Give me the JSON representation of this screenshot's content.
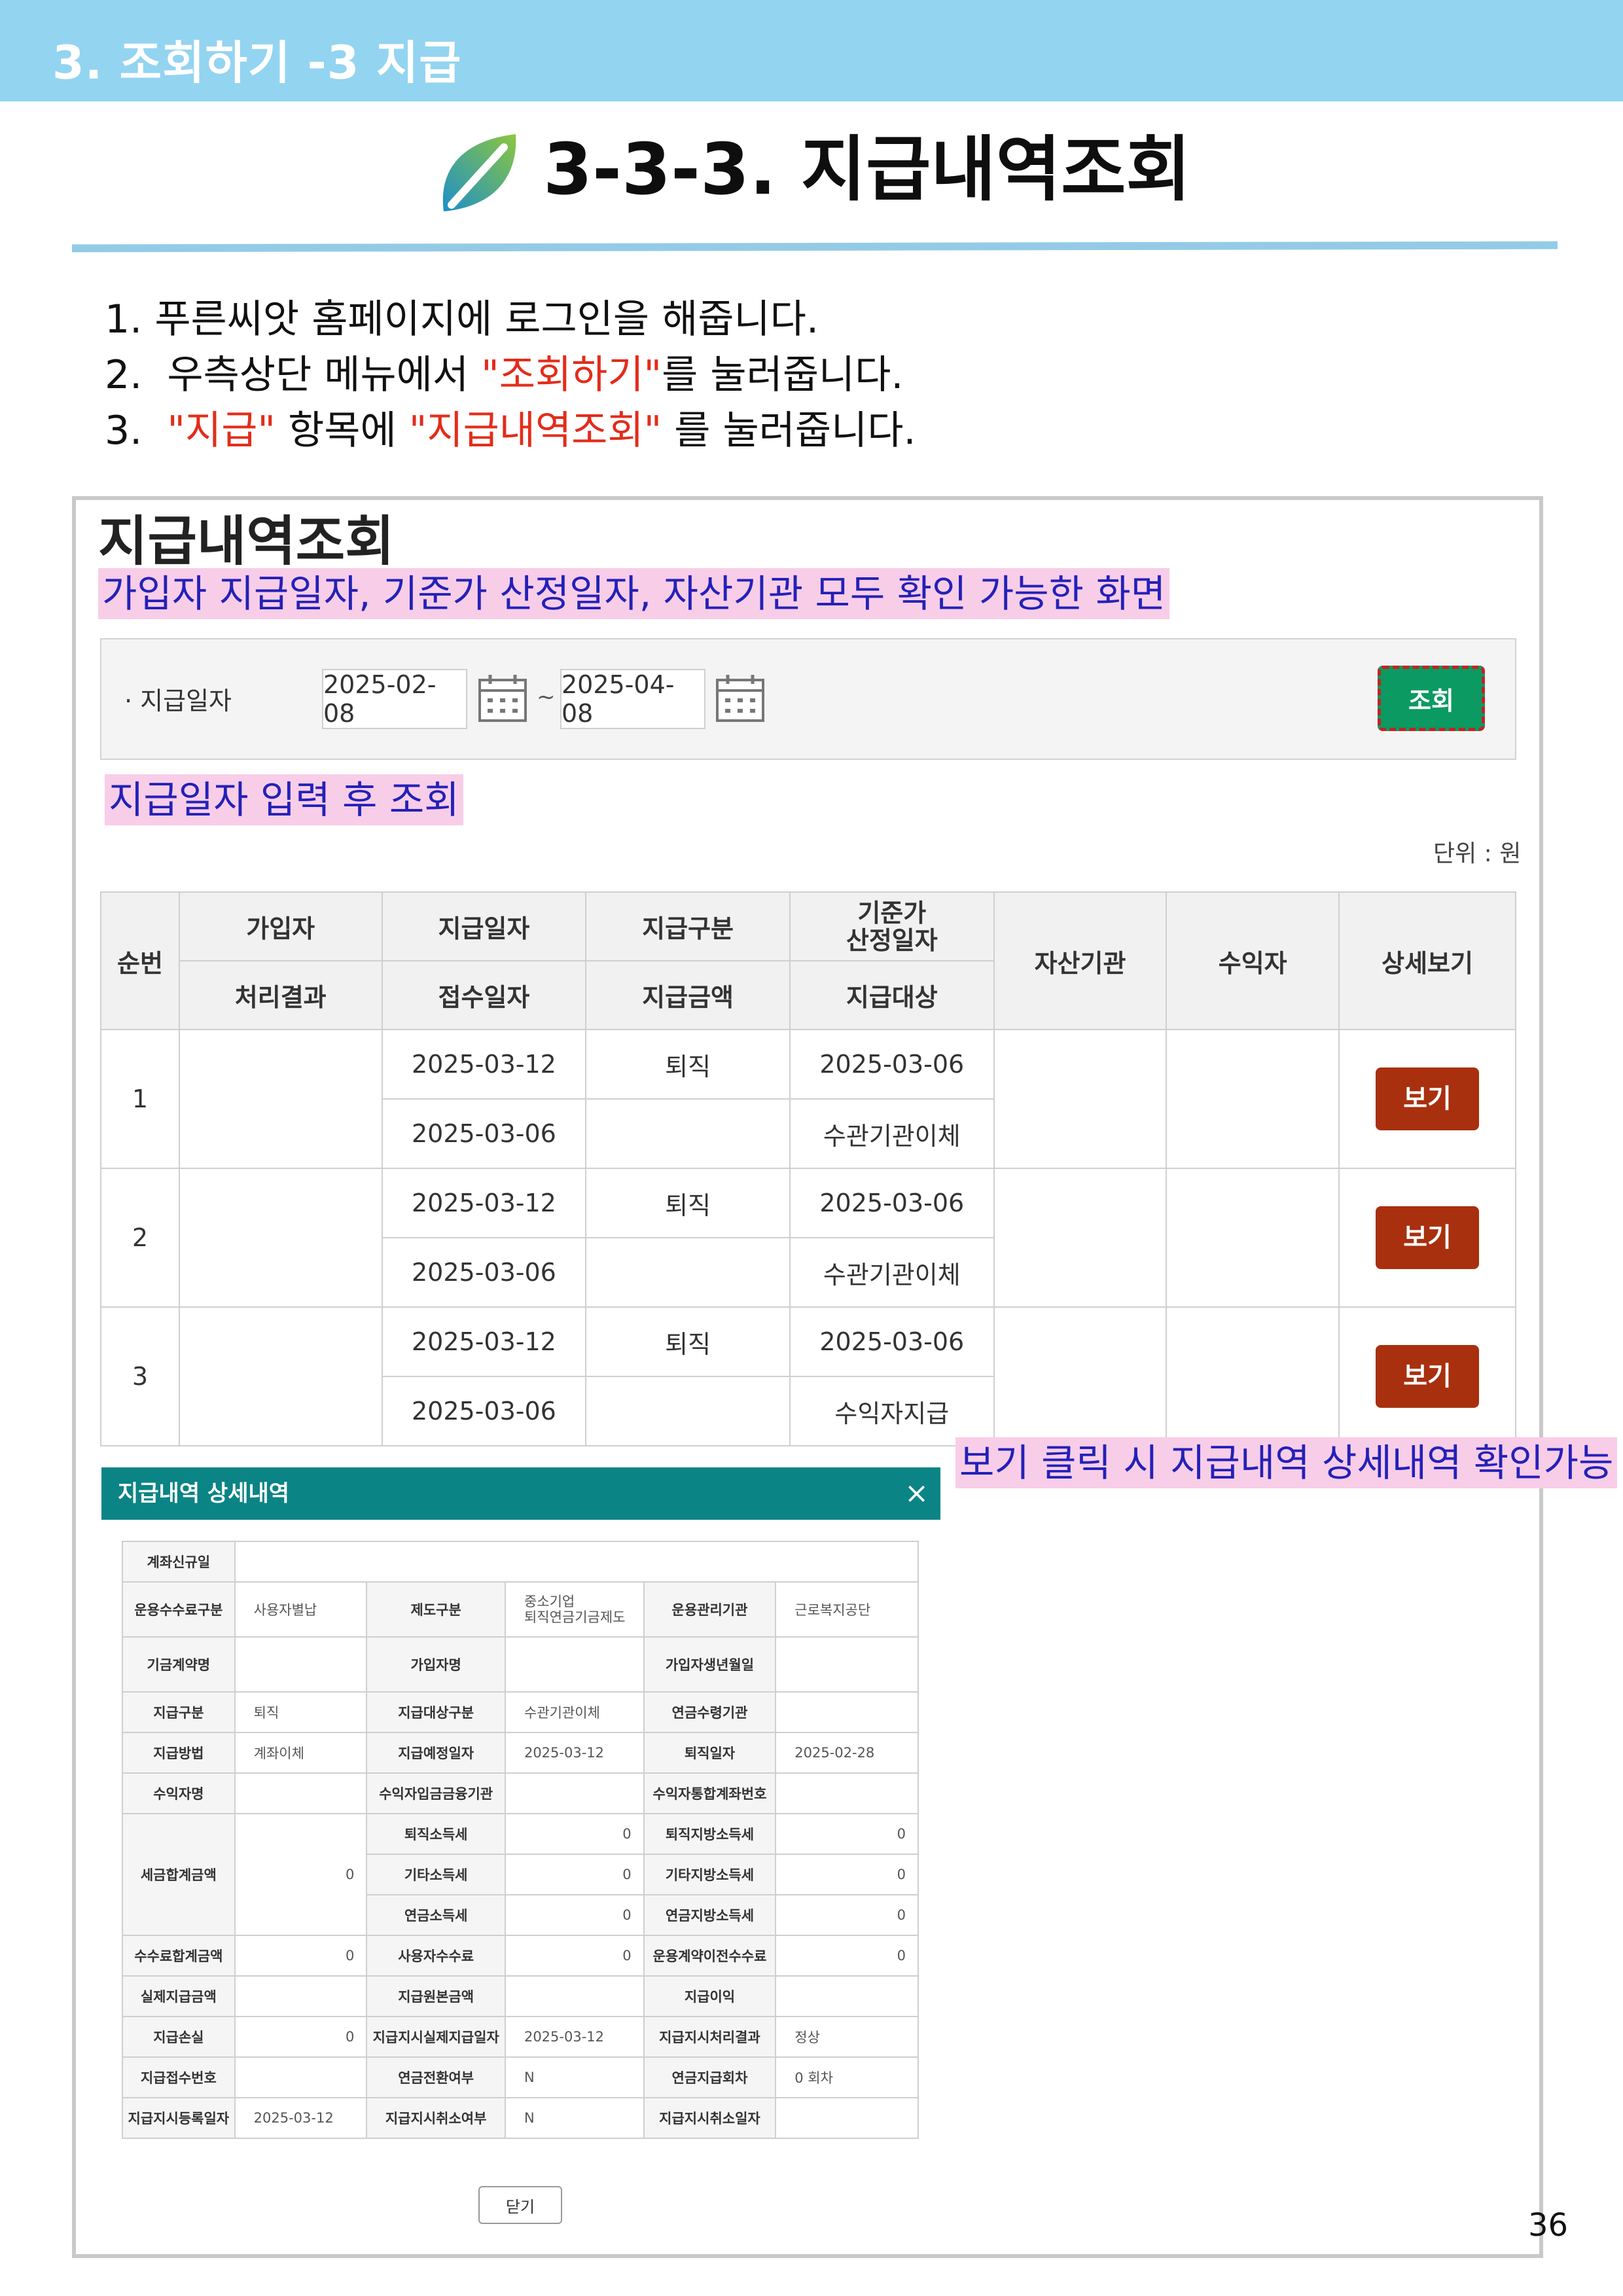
{
  "header": {
    "section": "3. 조회하기 -3 지급",
    "title": "3-3-3. 지급내역조회"
  },
  "instructions": [
    {
      "num": "1.",
      "parts": [
        {
          "t": "푸른씨앗 홈페이지에 로그인을 해줍니다.",
          "red": false
        }
      ]
    },
    {
      "num": "2.",
      "parts": [
        {
          "t": "우측상단 메뉴에서 ",
          "red": false
        },
        {
          "t": "\"조회하기\"",
          "red": true
        },
        {
          "t": "를 눌러줍니다.",
          "red": false
        }
      ]
    },
    {
      "num": "3.",
      "parts": [
        {
          "t": "\"지급\"",
          "red": true
        },
        {
          "t": " 항목에 ",
          "red": false
        },
        {
          "t": "\"지급내역조회\"",
          "red": true
        },
        {
          "t": " 를 눌러줍니다.",
          "red": false
        }
      ]
    }
  ],
  "screen": {
    "title": "지급내역조회",
    "note_top": "가입자 지급일자, 기준가 산정일자, 자산기관 모두 확인 가능한 화면",
    "search": {
      "label": "· 지급일자",
      "from": "2025-02-08",
      "sep": "~",
      "to": "2025-04-08",
      "button": "조회"
    },
    "note_search": "지급일자 입력 후 조회",
    "unit": "단위 : 원",
    "headers": {
      "no": "순번",
      "subscriber": "가입자",
      "result": "처리결과",
      "pay_date": "지급일자",
      "receipt_date": "접수일자",
      "pay_type": "지급구분",
      "pay_amount": "지급금액",
      "base_date_1": "기준가",
      "base_date_2": "산정일자",
      "pay_target": "지급대상",
      "asset_org": "자산기관",
      "beneficiary": "수익자",
      "detail": "상세보기"
    },
    "rows": [
      {
        "no": "1",
        "pay_date": "2025-03-12",
        "receipt_date": "2025-03-06",
        "pay_type": "퇴직",
        "base_date": "2025-03-06",
        "target": "수관기관이체",
        "button": "보기"
      },
      {
        "no": "2",
        "pay_date": "2025-03-12",
        "receipt_date": "2025-03-06",
        "pay_type": "퇴직",
        "base_date": "2025-03-06",
        "target": "수관기관이체",
        "button": "보기"
      },
      {
        "no": "3",
        "pay_date": "2025-03-12",
        "receipt_date": "2025-03-06",
        "pay_type": "퇴직",
        "base_date": "2025-03-06",
        "target": "수익자지급",
        "button": "보기"
      }
    ],
    "note_view": "보기 클릭 시 지급내역 상세내역 확인가능"
  },
  "popup": {
    "title": "지급내역 상세내역",
    "close_icon": "×",
    "labels": {
      "account_new": "계좌신규일",
      "fee_type": "운용수수료구분",
      "fee_type_val": "사용자별납",
      "system_type": "제도구분",
      "system_val_1": "중소기업",
      "system_val_2": "퇴직연금기금제도",
      "mgmt_org": "운용관리기관",
      "mgmt_org_val": "근로복지공단",
      "contract_name": "기금계약명",
      "subscriber_name": "가입자명",
      "birth": "가입자생년월일",
      "pay_type": "지급구분",
      "pay_type_val": "퇴직",
      "target_type": "지급대상구분",
      "target_type_val": "수관기관이체",
      "annuity_org": "연금수령기관",
      "pay_method": "지급방법",
      "pay_method_val": "계좌이체",
      "planned_date": "지급예정일자",
      "planned_date_val": "2025-03-12",
      "retire_date": "퇴직일자",
      "retire_date_val": "2025-02-28",
      "beneficiary": "수익자명",
      "ben_bank": "수익자입금금융기관",
      "ben_account": "수익자통합계좌번호",
      "tax_total": "세금합계금액",
      "tax_total_val": "0",
      "retire_tax": "퇴직소득세",
      "retire_tax_val": "0",
      "retire_local": "퇴직지방소득세",
      "retire_local_val": "0",
      "other_tax": "기타소득세",
      "other_tax_val": "0",
      "other_local": "기타지방소득세",
      "other_local_val": "0",
      "pension_tax": "연금소득세",
      "pension_tax_val": "0",
      "pension_local": "연금지방소득세",
      "pension_local_val": "0",
      "fee_total": "수수료합계금액",
      "fee_total_val": "0",
      "user_fee": "사용자수수료",
      "user_fee_val": "0",
      "transfer_fee": "운용계약이전수수료",
      "transfer_fee_val": "0",
      "actual_amount": "실제지급금액",
      "principal": "지급원본금액",
      "interest": "지급이익",
      "loss": "지급손실",
      "loss_val": "0",
      "exec_date": "지급지시실제지급일자",
      "exec_date_val": "2025-03-12",
      "exec_result": "지급지시처리결과",
      "exec_result_val": "정상",
      "receipt_no": "지급접수번호",
      "pension_switch": "연금전환여부",
      "pension_switch_val": "N",
      "pension_count": "연금지급회차",
      "pension_count_val": "0 회차",
      "order_date": "지급지시등록일자",
      "order_date_val": "2025-03-12",
      "cancel_flag": "지급지시취소여부",
      "cancel_flag_val": "N",
      "cancel_date": "지급지시취소일자"
    },
    "close_button": "닫기"
  },
  "page_number": "36",
  "colors": {
    "header_band": "#93d4f1",
    "accent_red": "#e32c1b",
    "note_bg": "#f8cde8",
    "note_text": "#2421b8",
    "search_btn": "#0b9a61",
    "view_btn": "#a8300f",
    "popup_head": "#0b8485"
  }
}
